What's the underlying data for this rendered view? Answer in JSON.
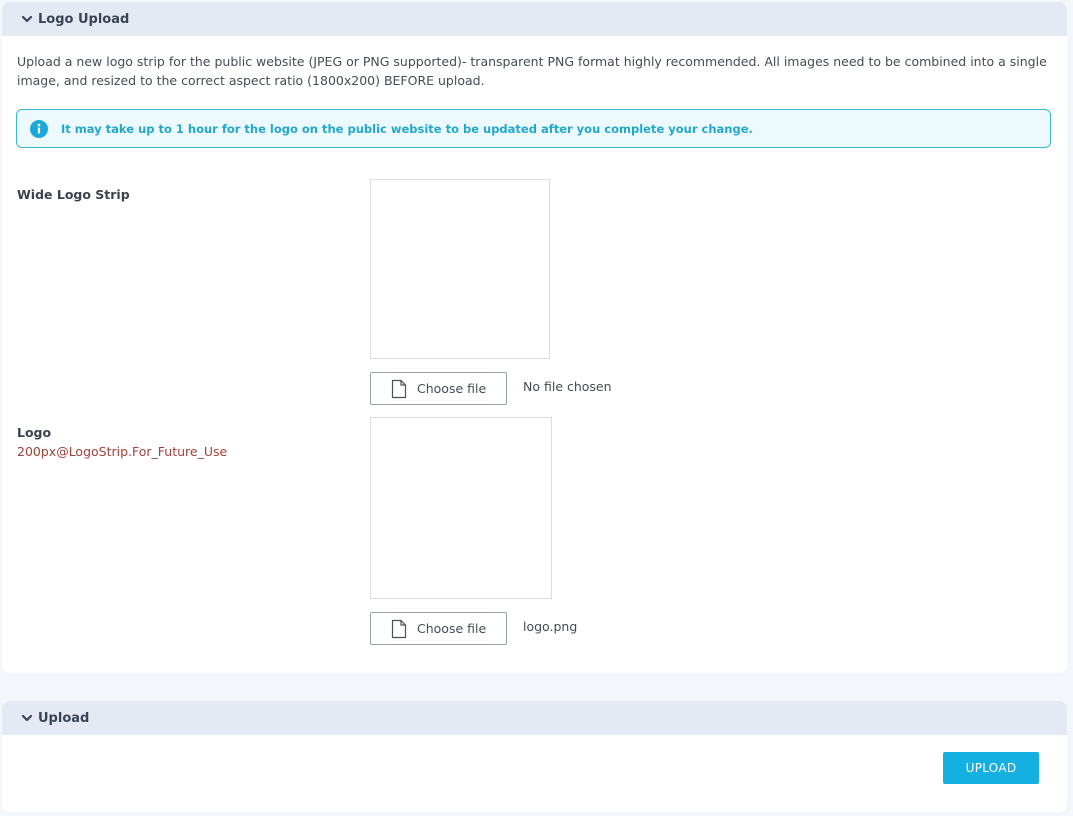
{
  "logo_panel": {
    "title": "Logo Upload",
    "description": "Upload a new logo strip for the public website (JPEG or PNG supported)- transparent PNG format highly recommended. All images need to be combined into a single image, and resized to the correct aspect ratio (1800x200) BEFORE upload.",
    "info_alert": "It may take up to 1 hour for the logo on the public website to be updated after you complete your change.",
    "wide_logo": {
      "label": "Wide Logo Strip",
      "button_label": "Choose file",
      "file_status": "No file chosen"
    },
    "logo": {
      "label": "Logo",
      "sublabel": "200px@LogoStrip.For_Future_Use",
      "button_label": "Choose file",
      "file_status": "logo.png"
    }
  },
  "upload_panel": {
    "title": "Upload",
    "button_label": "UPLOAD"
  },
  "colors": {
    "accent": "#14b0e2",
    "alert_border": "#37b8d5",
    "sublabel": "#a2413a",
    "header_bg": "#e4e9f3"
  },
  "icons": {
    "collapse": "chevron-down-icon",
    "info": "info-icon",
    "file": "file-icon"
  }
}
